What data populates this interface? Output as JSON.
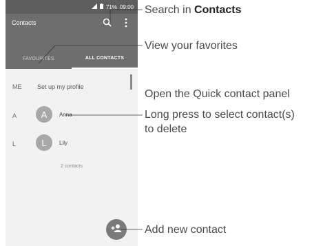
{
  "status_bar": {
    "time": "09:00",
    "battery": "71%"
  },
  "app_bar": {
    "title": "Contacts"
  },
  "tabs": [
    {
      "label": "FAVOURITES",
      "selected": false
    },
    {
      "label": "ALL CONTACTS",
      "selected": true
    }
  ],
  "profile": {
    "letter": "ME",
    "text": "Set up my profile"
  },
  "contacts": [
    {
      "section": "A",
      "initial": "A",
      "name": "Anna"
    },
    {
      "section": "L",
      "initial": "L",
      "name": "Lily"
    }
  ],
  "contact_count": "2 contacts",
  "annotations": {
    "search_prefix": "Search in ",
    "search_bold": "Contacts",
    "favorites": "View your favorites",
    "quick_contact": "Open the Quick contact panel",
    "long_press_1": "Long press to select contact(s)",
    "long_press_2": "to delete",
    "add_contact": "Add new contact"
  },
  "icons": [
    "signal-icon",
    "battery-icon",
    "search-icon",
    "more-vert-icon",
    "add-contact-icon"
  ],
  "colors": {
    "app_bar": "#6e6e6e",
    "status_bar": "#5e5e5e",
    "avatar": "#a8a8a8",
    "fab": "#7a7a7a"
  }
}
